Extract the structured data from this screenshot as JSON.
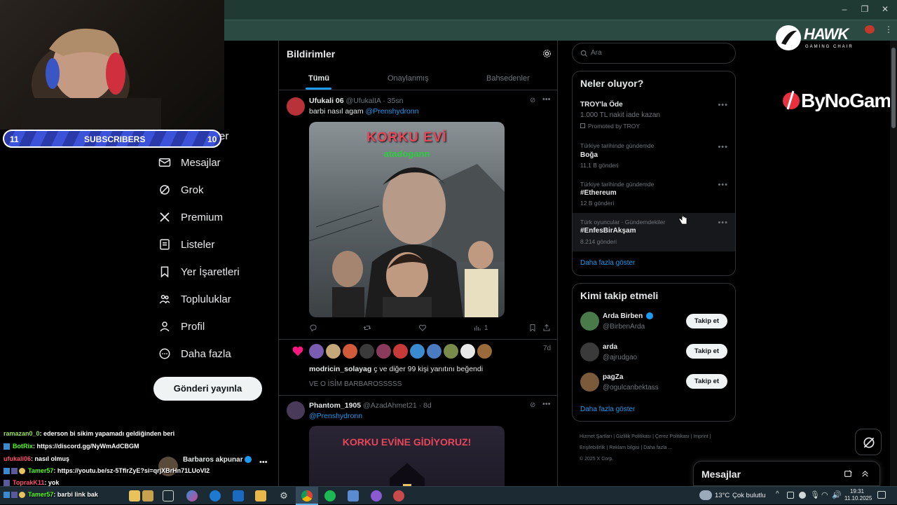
{
  "stream": {
    "subscribers_label": "SUBSCRIBERS",
    "sub_left": "11",
    "sub_right": "10",
    "hawk_title": "HAWK",
    "hawk_subtitle": "GAMING CHAIR",
    "bynogame": "ByNoGame"
  },
  "nav": {
    "partial_item": "er",
    "items": [
      {
        "label": "Mesajlar",
        "icon": "mail-icon"
      },
      {
        "label": "Grok",
        "icon": "grok-icon"
      },
      {
        "label": "Premium",
        "icon": "x-icon"
      },
      {
        "label": "Listeler",
        "icon": "list-icon"
      },
      {
        "label": "Yer İşaretleri",
        "icon": "bookmark-icon"
      },
      {
        "label": "Topluluklar",
        "icon": "communities-icon"
      },
      {
        "label": "Profil",
        "icon": "profile-icon"
      },
      {
        "label": "Daha fazla",
        "icon": "more-icon"
      }
    ],
    "post_button": "Gönderi yayınla",
    "account_name": "Barbaros akpunar"
  },
  "feed": {
    "title": "Bildirimler",
    "tabs": [
      "Tümü",
      "Onaylanmış",
      "Bahsedenler"
    ],
    "tweet1": {
      "name": "Ufukali 06",
      "handle": "@UfukalIA",
      "time": "35sn",
      "text": "barbi nasıl agam ",
      "mention": "@Prenshydronn",
      "image_title": "KORKU EVİ",
      "image_subtitle": "atadogann",
      "views": "1"
    },
    "likes": {
      "time": "7d",
      "user": "modricin_solayag",
      "extra": " ҫ ve diğer 99 kişi yanıtını beğendi",
      "quote": "VE O İSİM BARBAROSSSSS"
    },
    "tweet2": {
      "name": "Phantom_1905",
      "handle": "@AzadAhmet21",
      "time": "8d",
      "mention": "@Prenshydronn",
      "image_title": "KORKU EVİNE GİDİYORUZ!"
    }
  },
  "sidebar": {
    "search_placeholder": "Ara",
    "trends_title": "Neler oluyor?",
    "promo": {
      "name": "TROY'la Öde",
      "desc": "1.000 TL nakit iade kazan",
      "promoted": "Promoted by TROY"
    },
    "trends": [
      {
        "context": "Türkiye tarihinde gündemde",
        "name": "Boğa",
        "count": "11,1 B gönderi"
      },
      {
        "context": "Türkiye tarihinde gündemde",
        "name": "#Ethereum",
        "count": "12 B gönderi"
      },
      {
        "context": "Türk oyuncular · Gündemdekiler",
        "name": "#EnfesBirAkşam",
        "count": "8.214 gönderi"
      }
    ],
    "show_more": "Daha fazla göster",
    "who_title": "Kimi takip etmeli",
    "who": [
      {
        "name": "Arda Birben",
        "handle": "@BirbenArda",
        "verified": true
      },
      {
        "name": "arda",
        "handle": "@ajrudgao",
        "verified": false
      },
      {
        "name": "pagZa",
        "handle": "@ogulcanbektass",
        "verified": false
      }
    ],
    "follow_label": "Takip et",
    "footer": [
      "Hizmet Şartları",
      "Gizlilik Politikası",
      "Çerez Politikası",
      "Imprint",
      "Erişilebilirlik",
      "Reklam bilgisi",
      "Daha fazla ...",
      "© 2025 X Corp."
    ],
    "messages": "Mesajlar"
  },
  "chat": [
    {
      "user": "ramazan0_0",
      "text": ": ederson bi sikim yapamadı geldiğinden beri",
      "color": "#9be15d"
    },
    {
      "user": "BotRix",
      "text": ": https://discord.gg/NyWmAdCBGM",
      "color": "#53fc18"
    },
    {
      "user": "ufukali06",
      "text": ": nasıl olmuş",
      "color": "#ff4d6d"
    },
    {
      "user": "Tamer57",
      "text": ": https://youtu.be/sz-5TflrZyE?si=qrjXBrHn71LUoVI2",
      "color": "#53fc18"
    },
    {
      "user": "ToprakK11",
      "text": ": yok",
      "color": "#ff4d6d"
    },
    {
      "user": "Tamer57",
      "text": ": barbi link bak",
      "color": "#53fc18"
    }
  ],
  "taskbar": {
    "weather": "13°C",
    "weather_desc": "Çok bulutlu",
    "time": "19:31",
    "date": "11.10.2025"
  }
}
